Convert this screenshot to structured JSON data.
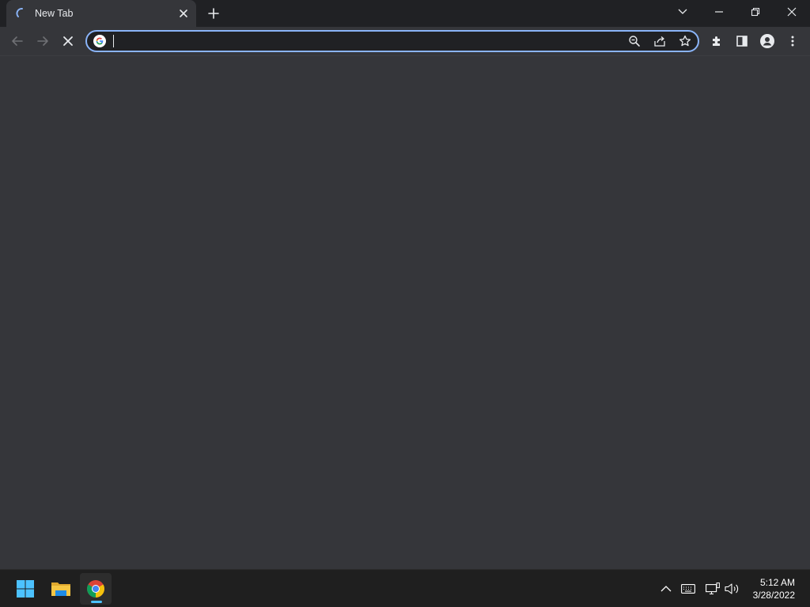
{
  "browser": {
    "tab": {
      "title": "New Tab"
    },
    "omnibox": {
      "value": "",
      "placeholder": ""
    }
  },
  "taskbar": {
    "apps": [
      {
        "name": "Start",
        "icon": "windows-start-icon"
      },
      {
        "name": "File Explorer",
        "icon": "folder-icon"
      },
      {
        "name": "Google Chrome",
        "icon": "chrome-icon",
        "active": true
      }
    ],
    "clock": {
      "time": "5:12 AM",
      "date": "3/28/2022"
    }
  },
  "colors": {
    "titlebar": "#202124",
    "toolbar": "#35363a",
    "accent": "#8ab4f8",
    "taskbar": "#1f1f1f",
    "taskbar_indicator": "#4cc2ff"
  }
}
